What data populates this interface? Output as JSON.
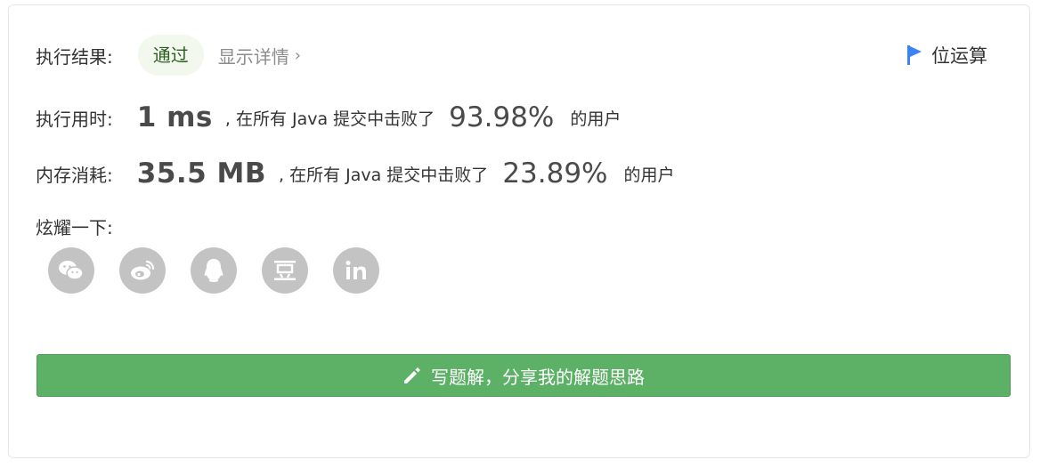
{
  "result": {
    "label": "执行结果:",
    "status": "通过",
    "details_link": "显示详情",
    "tag": "位运算"
  },
  "metrics": [
    {
      "label": "执行用时:",
      "value": "1 ms",
      "compare_text": ", 在所有 Java 提交中击败了",
      "percent": "93.98%",
      "suffix": "的用户"
    },
    {
      "label": "内存消耗:",
      "value": "35.5 MB",
      "compare_text": ", 在所有 Java 提交中击败了",
      "percent": "23.89%",
      "suffix": "的用户"
    }
  ],
  "share": {
    "label": "炫耀一下:",
    "icons": [
      "wechat-icon",
      "weibo-icon",
      "qq-icon",
      "douban-icon",
      "linkedin-icon"
    ]
  },
  "cta": {
    "label": "写题解，分享我的解题思路"
  },
  "colors": {
    "accent_green": "#5db167",
    "pill_bg": "#f3f8ef",
    "flag_blue": "#3b82f6",
    "icon_gray": "#c3c3c3"
  }
}
